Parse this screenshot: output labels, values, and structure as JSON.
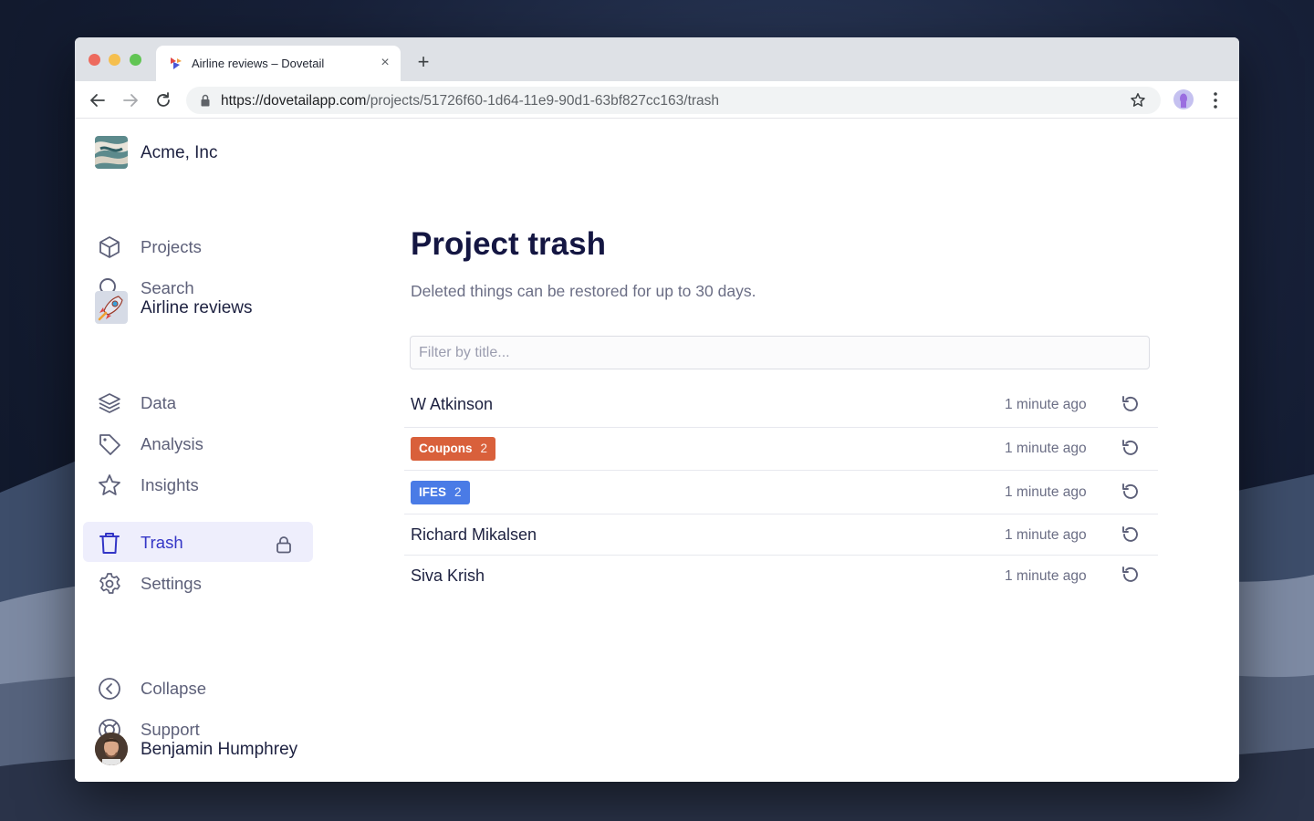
{
  "browser": {
    "tab_title": "Airline reviews – Dovetail",
    "close_glyph": "×",
    "new_tab_glyph": "+",
    "url_host": "https://dovetailapp.com",
    "url_path": "/projects/51726f60-1d64-11e9-90d1-63bf827cc163/trash"
  },
  "sidebar": {
    "org_name": "Acme, Inc",
    "top_nav": [
      {
        "label": "Projects",
        "icon": "cube-icon"
      },
      {
        "label": "Search",
        "icon": "search-icon"
      }
    ],
    "project_name": "Airline reviews",
    "project_nav": [
      {
        "label": "Data",
        "icon": "layers-icon"
      },
      {
        "label": "Analysis",
        "icon": "tag-icon"
      },
      {
        "label": "Insights",
        "icon": "star-icon"
      },
      {
        "label": "Trash",
        "icon": "trash-icon",
        "active": true
      },
      {
        "label": "Settings",
        "icon": "gear-icon",
        "locked": true
      }
    ],
    "bottom_nav": [
      {
        "label": "Collapse",
        "icon": "chevron-left-circle-icon"
      },
      {
        "label": "Support",
        "icon": "lifebuoy-icon"
      }
    ],
    "user_name": "Benjamin Humphrey"
  },
  "main": {
    "title": "Project trash",
    "subtitle": "Deleted things can be restored for up to 30 days.",
    "filter_placeholder": "Filter by title...",
    "items": [
      {
        "type": "text",
        "title": "W Atkinson",
        "time": "1 minute ago"
      },
      {
        "type": "tag",
        "title": "Coupons",
        "count": "2",
        "color": "#d9603b",
        "time": "1 minute ago"
      },
      {
        "type": "tag",
        "title": "IFES",
        "count": "2",
        "color": "#4a7be6",
        "time": "1 minute ago"
      },
      {
        "type": "text",
        "title": "Richard Mikalsen",
        "time": "1 minute ago"
      },
      {
        "type": "text",
        "title": "Siva Krish",
        "time": "1 minute ago"
      }
    ]
  },
  "colors": {
    "accent": "#3335c6",
    "active_bg": "#eeeefc",
    "title": "#141642"
  }
}
